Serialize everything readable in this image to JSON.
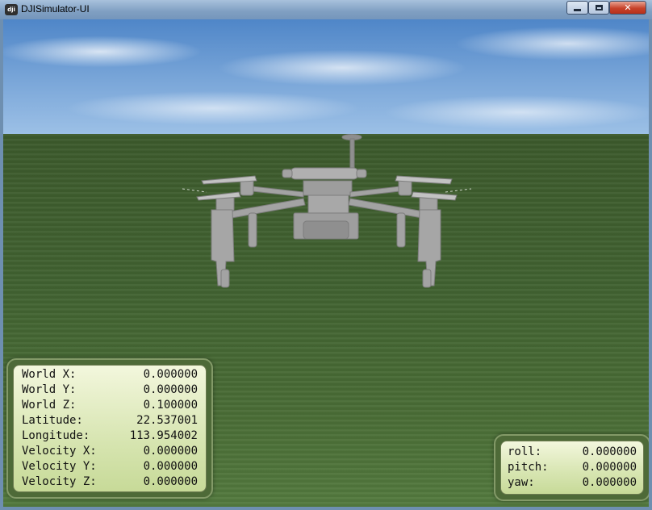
{
  "window": {
    "title": "DJISimulator-UI",
    "app_icon": "dji-logo-icon",
    "controls": {
      "minimize": "minimize-icon",
      "maximize": "maximize-icon",
      "close_label": "✕"
    }
  },
  "telemetry": {
    "rows": [
      {
        "label": "World X:",
        "value": "0.000000"
      },
      {
        "label": "World Y:",
        "value": "0.000000"
      },
      {
        "label": "World Z:",
        "value": "0.100000"
      },
      {
        "label": "Latitude:",
        "value": "22.537001"
      },
      {
        "label": "Longitude:",
        "value": "113.954002"
      },
      {
        "label": "Velocity X:",
        "value": "0.000000"
      },
      {
        "label": "Velocity Y:",
        "value": "0.000000"
      },
      {
        "label": "Velocity Z:",
        "value": "0.000000"
      }
    ]
  },
  "attitude": {
    "rows": [
      {
        "label": "roll:",
        "value": "0.000000"
      },
      {
        "label": "pitch:",
        "value": "0.000000"
      },
      {
        "label": "yaw:",
        "value": "0.000000"
      }
    ]
  },
  "colors": {
    "sky": "#6f9fd6",
    "ground": "#44663a",
    "hud_panel": "#d7e5b1",
    "hud_frame": "#4e6a38",
    "drone": "#9a9a9a"
  }
}
